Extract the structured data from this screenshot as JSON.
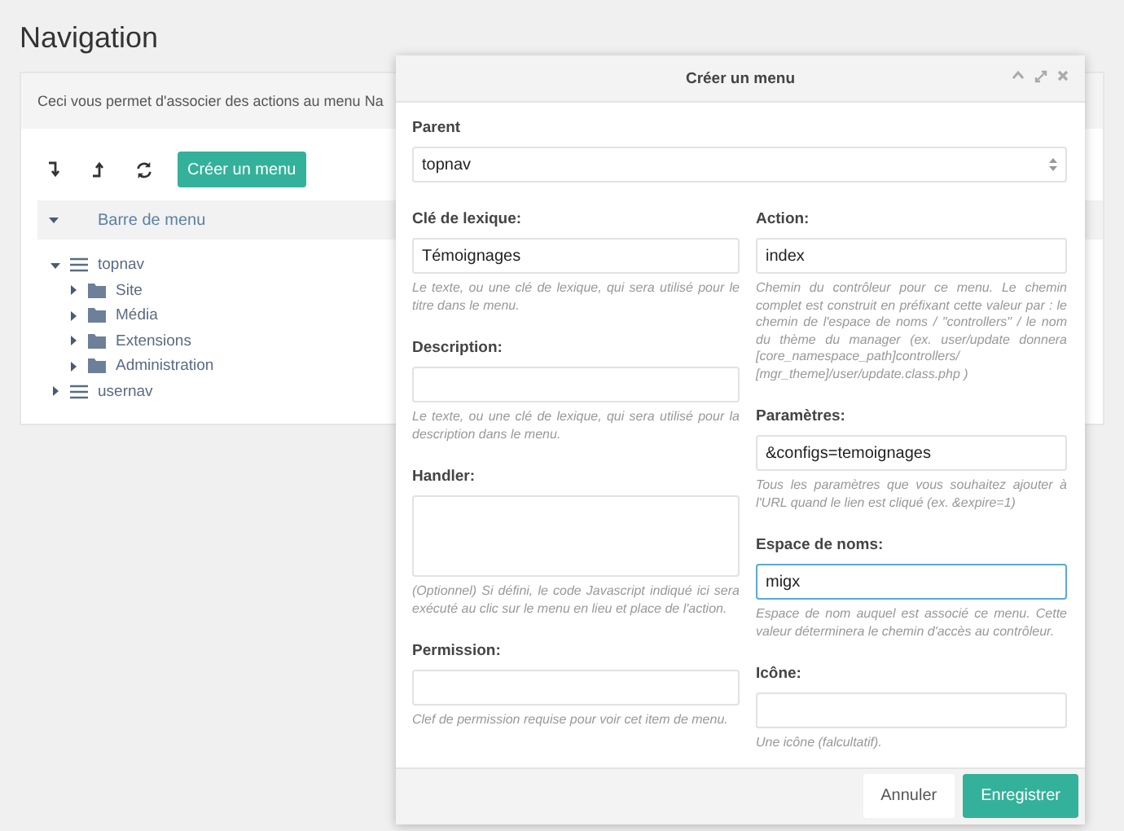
{
  "page": {
    "title": "Navigation"
  },
  "panel": {
    "description": "Ceci vous permet d'associer des actions au menu Na",
    "create_button": "Créer un menu",
    "tree_header": {
      "label": "Barre de menu",
      "expanded": true
    },
    "tree": [
      {
        "label": "topnav",
        "kind": "menu",
        "expanded": true,
        "children": [
          {
            "label": "Site",
            "kind": "folder",
            "expanded": false
          },
          {
            "label": "Média",
            "kind": "folder",
            "expanded": false
          },
          {
            "label": "Extensions",
            "kind": "folder",
            "expanded": false
          },
          {
            "label": "Administration",
            "kind": "folder",
            "expanded": false
          }
        ]
      },
      {
        "label": "usernav",
        "kind": "menu",
        "expanded": false
      }
    ]
  },
  "dialog": {
    "title": "Créer un menu",
    "parent": {
      "label": "Parent",
      "value": "topnav"
    },
    "left": [
      {
        "label": "Clé de lexique:",
        "kind": "text",
        "value": "Témoignages",
        "focused": false,
        "help": "Le texte, ou une clé de lexique, qui sera utilisé pour le titre dans le menu."
      },
      {
        "label": "Description:",
        "kind": "text",
        "focused": false,
        "help": "Le texte, ou une clé de lexique, qui sera utilisé pour la description dans le menu."
      },
      {
        "label": "Handler:",
        "kind": "textarea",
        "focused": false,
        "help": "(Optionnel) Si défini, le code Javascript indiqué ici sera exécuté au clic sur le menu en lieu et place de l'action."
      },
      {
        "label": "Permission:",
        "kind": "text",
        "focused": false,
        "help": "Clef de permission requise pour voir cet item de menu."
      }
    ],
    "right": [
      {
        "label": "Action:",
        "kind": "text",
        "value": "index",
        "focused": false,
        "help": "Chemin du contrôleur pour ce menu. Le chemin complet est construit en préfixant cette valeur par : le chemin de l'espace de noms / \"controllers\" / le nom du thème du manager (ex. user/update donnera [core_namespace_path]controllers/ [mgr_theme]/user/update.class.php )"
      },
      {
        "label": "Paramètres:",
        "kind": "text",
        "value": "&configs=temoignages",
        "focused": false,
        "help": "Tous les paramètres que vous souhaitez ajouter à l'URL quand le lien est cliqué (ex. &expire=1)"
      },
      {
        "label": "Espace de noms:",
        "kind": "text",
        "value": "migx",
        "focused": true,
        "help": "Espace de nom auquel est associé ce menu. Cette valeur déterminera le chemin d'accès au contrôleur."
      },
      {
        "label": "Icône:",
        "kind": "text",
        "focused": false,
        "help": "Une icône (falcultatif)."
      }
    ],
    "buttons": [
      {
        "label": "Annuler",
        "kind": "secondary"
      },
      {
        "label": "Enregistrer",
        "kind": "primary"
      }
    ]
  }
}
